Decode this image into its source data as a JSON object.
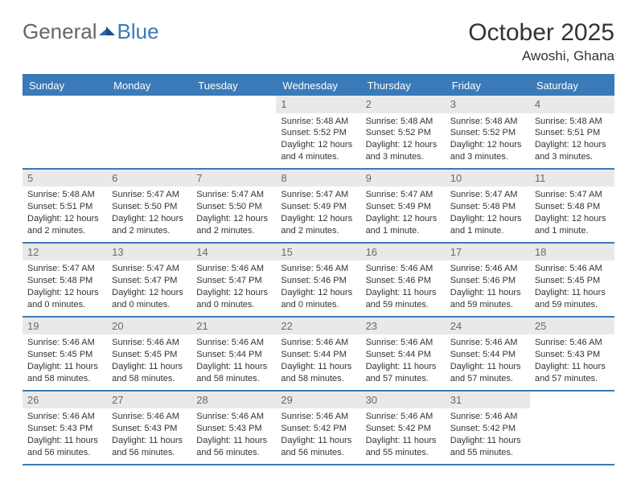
{
  "brand": {
    "part1": "General",
    "part2": "Blue"
  },
  "title": "October 2025",
  "location": "Awoshi, Ghana",
  "daynames": [
    "Sunday",
    "Monday",
    "Tuesday",
    "Wednesday",
    "Thursday",
    "Friday",
    "Saturday"
  ],
  "weeks": [
    [
      {
        "day": "",
        "sunrise": "",
        "sunset": "",
        "daylight": ""
      },
      {
        "day": "",
        "sunrise": "",
        "sunset": "",
        "daylight": ""
      },
      {
        "day": "",
        "sunrise": "",
        "sunset": "",
        "daylight": ""
      },
      {
        "day": "1",
        "sunrise": "Sunrise: 5:48 AM",
        "sunset": "Sunset: 5:52 PM",
        "daylight": "Daylight: 12 hours and 4 minutes."
      },
      {
        "day": "2",
        "sunrise": "Sunrise: 5:48 AM",
        "sunset": "Sunset: 5:52 PM",
        "daylight": "Daylight: 12 hours and 3 minutes."
      },
      {
        "day": "3",
        "sunrise": "Sunrise: 5:48 AM",
        "sunset": "Sunset: 5:52 PM",
        "daylight": "Daylight: 12 hours and 3 minutes."
      },
      {
        "day": "4",
        "sunrise": "Sunrise: 5:48 AM",
        "sunset": "Sunset: 5:51 PM",
        "daylight": "Daylight: 12 hours and 3 minutes."
      }
    ],
    [
      {
        "day": "5",
        "sunrise": "Sunrise: 5:48 AM",
        "sunset": "Sunset: 5:51 PM",
        "daylight": "Daylight: 12 hours and 2 minutes."
      },
      {
        "day": "6",
        "sunrise": "Sunrise: 5:47 AM",
        "sunset": "Sunset: 5:50 PM",
        "daylight": "Daylight: 12 hours and 2 minutes."
      },
      {
        "day": "7",
        "sunrise": "Sunrise: 5:47 AM",
        "sunset": "Sunset: 5:50 PM",
        "daylight": "Daylight: 12 hours and 2 minutes."
      },
      {
        "day": "8",
        "sunrise": "Sunrise: 5:47 AM",
        "sunset": "Sunset: 5:49 PM",
        "daylight": "Daylight: 12 hours and 2 minutes."
      },
      {
        "day": "9",
        "sunrise": "Sunrise: 5:47 AM",
        "sunset": "Sunset: 5:49 PM",
        "daylight": "Daylight: 12 hours and 1 minute."
      },
      {
        "day": "10",
        "sunrise": "Sunrise: 5:47 AM",
        "sunset": "Sunset: 5:48 PM",
        "daylight": "Daylight: 12 hours and 1 minute."
      },
      {
        "day": "11",
        "sunrise": "Sunrise: 5:47 AM",
        "sunset": "Sunset: 5:48 PM",
        "daylight": "Daylight: 12 hours and 1 minute."
      }
    ],
    [
      {
        "day": "12",
        "sunrise": "Sunrise: 5:47 AM",
        "sunset": "Sunset: 5:48 PM",
        "daylight": "Daylight: 12 hours and 0 minutes."
      },
      {
        "day": "13",
        "sunrise": "Sunrise: 5:47 AM",
        "sunset": "Sunset: 5:47 PM",
        "daylight": "Daylight: 12 hours and 0 minutes."
      },
      {
        "day": "14",
        "sunrise": "Sunrise: 5:46 AM",
        "sunset": "Sunset: 5:47 PM",
        "daylight": "Daylight: 12 hours and 0 minutes."
      },
      {
        "day": "15",
        "sunrise": "Sunrise: 5:46 AM",
        "sunset": "Sunset: 5:46 PM",
        "daylight": "Daylight: 12 hours and 0 minutes."
      },
      {
        "day": "16",
        "sunrise": "Sunrise: 5:46 AM",
        "sunset": "Sunset: 5:46 PM",
        "daylight": "Daylight: 11 hours and 59 minutes."
      },
      {
        "day": "17",
        "sunrise": "Sunrise: 5:46 AM",
        "sunset": "Sunset: 5:46 PM",
        "daylight": "Daylight: 11 hours and 59 minutes."
      },
      {
        "day": "18",
        "sunrise": "Sunrise: 5:46 AM",
        "sunset": "Sunset: 5:45 PM",
        "daylight": "Daylight: 11 hours and 59 minutes."
      }
    ],
    [
      {
        "day": "19",
        "sunrise": "Sunrise: 5:46 AM",
        "sunset": "Sunset: 5:45 PM",
        "daylight": "Daylight: 11 hours and 58 minutes."
      },
      {
        "day": "20",
        "sunrise": "Sunrise: 5:46 AM",
        "sunset": "Sunset: 5:45 PM",
        "daylight": "Daylight: 11 hours and 58 minutes."
      },
      {
        "day": "21",
        "sunrise": "Sunrise: 5:46 AM",
        "sunset": "Sunset: 5:44 PM",
        "daylight": "Daylight: 11 hours and 58 minutes."
      },
      {
        "day": "22",
        "sunrise": "Sunrise: 5:46 AM",
        "sunset": "Sunset: 5:44 PM",
        "daylight": "Daylight: 11 hours and 58 minutes."
      },
      {
        "day": "23",
        "sunrise": "Sunrise: 5:46 AM",
        "sunset": "Sunset: 5:44 PM",
        "daylight": "Daylight: 11 hours and 57 minutes."
      },
      {
        "day": "24",
        "sunrise": "Sunrise: 5:46 AM",
        "sunset": "Sunset: 5:44 PM",
        "daylight": "Daylight: 11 hours and 57 minutes."
      },
      {
        "day": "25",
        "sunrise": "Sunrise: 5:46 AM",
        "sunset": "Sunset: 5:43 PM",
        "daylight": "Daylight: 11 hours and 57 minutes."
      }
    ],
    [
      {
        "day": "26",
        "sunrise": "Sunrise: 5:46 AM",
        "sunset": "Sunset: 5:43 PM",
        "daylight": "Daylight: 11 hours and 56 minutes."
      },
      {
        "day": "27",
        "sunrise": "Sunrise: 5:46 AM",
        "sunset": "Sunset: 5:43 PM",
        "daylight": "Daylight: 11 hours and 56 minutes."
      },
      {
        "day": "28",
        "sunrise": "Sunrise: 5:46 AM",
        "sunset": "Sunset: 5:43 PM",
        "daylight": "Daylight: 11 hours and 56 minutes."
      },
      {
        "day": "29",
        "sunrise": "Sunrise: 5:46 AM",
        "sunset": "Sunset: 5:42 PM",
        "daylight": "Daylight: 11 hours and 56 minutes."
      },
      {
        "day": "30",
        "sunrise": "Sunrise: 5:46 AM",
        "sunset": "Sunset: 5:42 PM",
        "daylight": "Daylight: 11 hours and 55 minutes."
      },
      {
        "day": "31",
        "sunrise": "Sunrise: 5:46 AM",
        "sunset": "Sunset: 5:42 PM",
        "daylight": "Daylight: 11 hours and 55 minutes."
      },
      {
        "day": "",
        "sunrise": "",
        "sunset": "",
        "daylight": ""
      }
    ]
  ]
}
